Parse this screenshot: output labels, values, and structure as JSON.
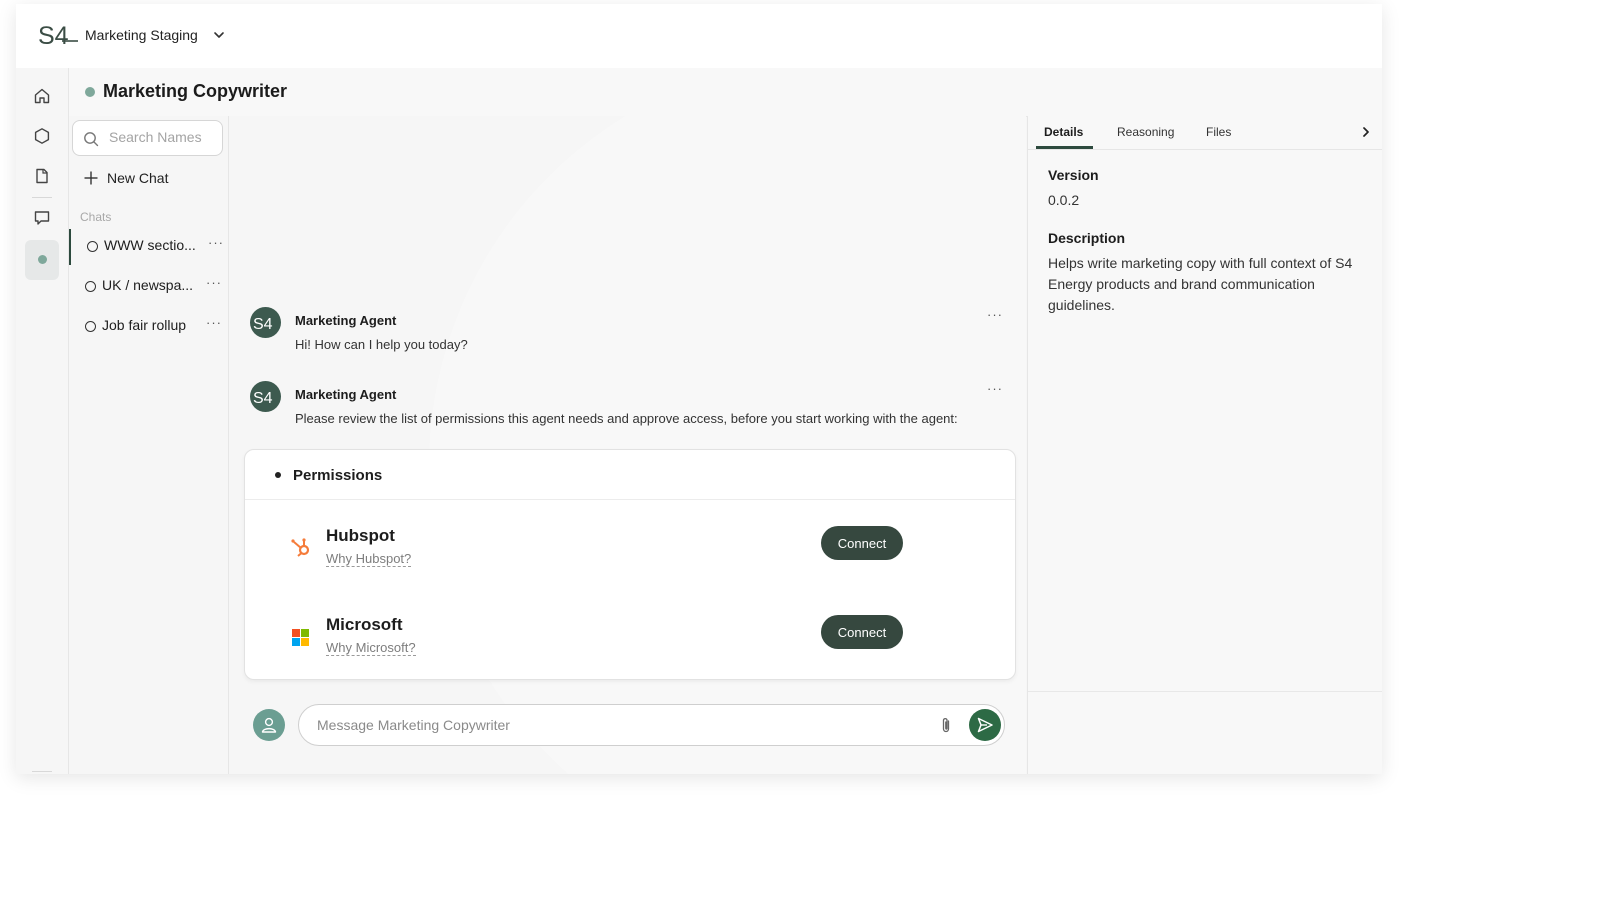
{
  "workspace": {
    "name": "Marketing Staging"
  },
  "agent": {
    "title": "Marketing Copywriter"
  },
  "chatlist": {
    "search_placeholder": "Search Names",
    "new_chat_label": "New Chat",
    "section_label": "Chats",
    "items": [
      {
        "label": "WWW sectio...",
        "more": "···"
      },
      {
        "label": "UK / newspa...",
        "more": "···"
      },
      {
        "label": "Job fair rollup",
        "more": "···"
      }
    ]
  },
  "messages": [
    {
      "author": "Marketing Agent",
      "text": "Hi! How can I help you today?",
      "more": "···"
    },
    {
      "author": "Marketing Agent",
      "text": "Please review the list of permissions this agent needs and approve access, before you start working with the agent:",
      "more": "···"
    }
  ],
  "permissions": {
    "title": "Permissions",
    "items": [
      {
        "name": "Hubspot",
        "why": "Why Hubspot?",
        "button": "Connect",
        "icon": "hubspot-icon"
      },
      {
        "name": "Microsoft",
        "why": "Why Microsoft?",
        "button": "Connect",
        "icon": "microsoft-icon"
      }
    ]
  },
  "composer": {
    "placeholder": "Message Marketing Copywriter"
  },
  "details": {
    "tabs": [
      "Details",
      "Reasoning",
      "Files"
    ],
    "version_label": "Version",
    "version_value": "0.0.2",
    "description_label": "Description",
    "description_value": "Helps write marketing copy with full context of S4 Energy products and brand communication guidelines."
  },
  "colors": {
    "brand_dark": "#36483f",
    "status_dot": "#7fa89b",
    "send_green": "#2d6a45",
    "hubspot_orange": "#f57c3b"
  }
}
